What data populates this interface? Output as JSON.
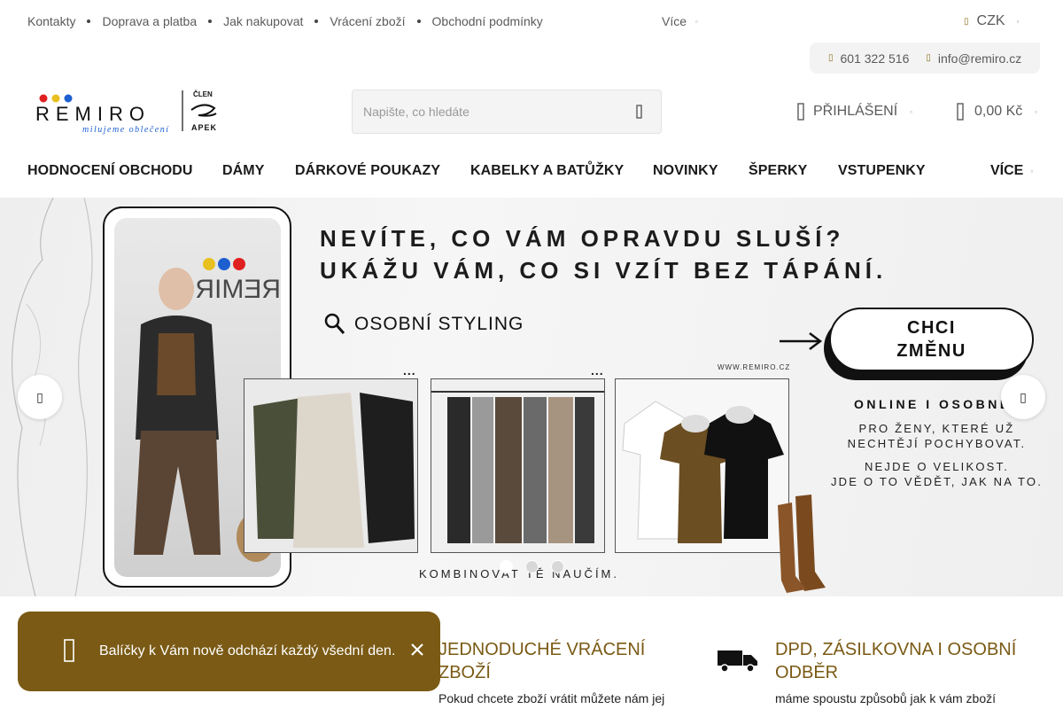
{
  "topbar": {
    "links": [
      "Kontakty",
      "Doprava a platba",
      "Jak nakupovat",
      "Vrácení zboží",
      "Obchodní podmínky"
    ],
    "more_label": "Více",
    "currency": "CZK"
  },
  "contact": {
    "phone": "601 322 516",
    "email": "info@remiro.cz"
  },
  "logo": {
    "brand": "REMIRO",
    "tagline": "milujeme oblečení",
    "member_label": "ČLEN",
    "member_org": "APEK"
  },
  "search": {
    "placeholder": "Napište, co hledáte"
  },
  "header": {
    "login_label": "PŘIHLÁŠENÍ",
    "cart_total": "0,00 Kč"
  },
  "nav": {
    "items": [
      "HODNOCENÍ OBCHODU",
      "DÁMY",
      "DÁRKOVÉ POUKAZY",
      "KABELKY A BATŮŽKY",
      "NOVINKY",
      "ŠPERKY",
      "VSTUPENKY"
    ],
    "more_label": "VÍCE"
  },
  "banner": {
    "headline_1": "NEVÍTE, CO VÁM OPRAVDU SLUŠÍ?",
    "headline_2": "UKÁŽU VÁM, CO SI VZÍT BEZ TÁPÁNÍ.",
    "styling_label": "OSOBNÍ STYLING",
    "cta_line_1": "CHCI",
    "cta_line_2": "ZMĚNU",
    "website": "WWW.REMIRO.CZ",
    "online_label": "ONLINE I OSOBNĚ",
    "promo_1": "PRO ŽENY, KTERÉ UŽ",
    "promo_2": "NECHTĚJÍ POCHYBOVAT.",
    "promo_3": "NEJDE O VELIKOST.",
    "promo_4": "JDE O TO VĚDĚT, JAK NA TO.",
    "bottom_text": "KOMBINOVAT TĚ NAUČÍM.",
    "phone_sign": "REMIRO",
    "ellipsis": "..."
  },
  "benefits": [
    {
      "title": "JEDNODUCHÉ VRÁCENÍ ZBOŽÍ",
      "text": "Pokud chcete zboží vrátit můžete nám jej"
    },
    {
      "title": "DPD, ZÁSILKOVNA I OSOBNÍ ODBĚR",
      "text": "máme spoustu způsobů jak k vám zboží"
    }
  ],
  "toast": {
    "message": "Balíčky k Vám nově odchází každý všední den."
  },
  "colors": {
    "accent": "#7a5a14",
    "text": "#222222",
    "muted": "#5a5a5a"
  },
  "icons": {
    "phone": "phone-icon",
    "email": "email-icon",
    "search": "search-icon",
    "user": "user-icon",
    "cart": "cart-icon",
    "truck": "truck-icon",
    "close": "close-icon",
    "info": "info-icon"
  }
}
